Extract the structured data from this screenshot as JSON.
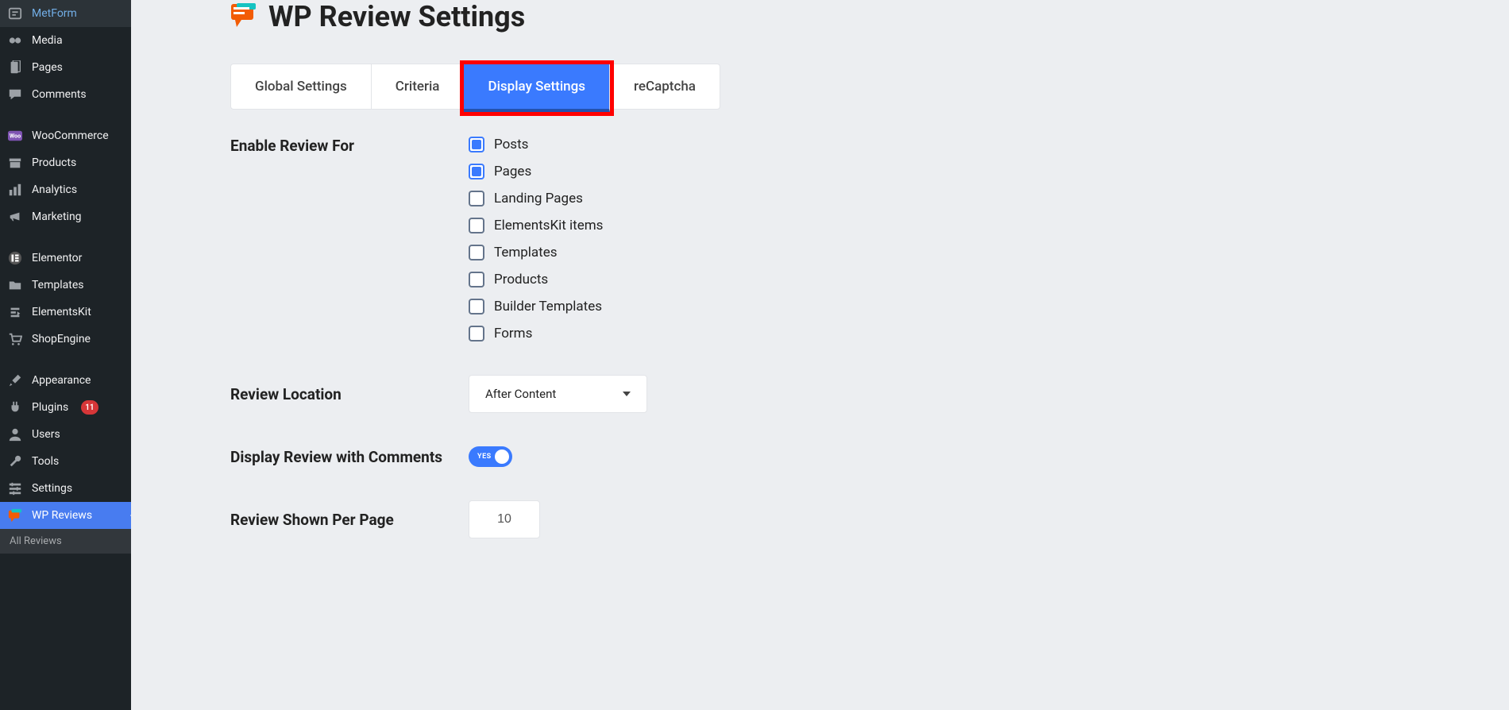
{
  "sidebar": {
    "items": [
      {
        "icon": "form",
        "label": "MetForm"
      },
      {
        "icon": "media",
        "label": "Media"
      },
      {
        "icon": "page",
        "label": "Pages"
      },
      {
        "icon": "comment",
        "label": "Comments"
      },
      {
        "icon": "woo",
        "label": "WooCommerce"
      },
      {
        "icon": "archive",
        "label": "Products"
      },
      {
        "icon": "chart",
        "label": "Analytics"
      },
      {
        "icon": "megaphone",
        "label": "Marketing"
      },
      {
        "icon": "elementor",
        "label": "Elementor"
      },
      {
        "icon": "folder",
        "label": "Templates"
      },
      {
        "icon": "elementskit",
        "label": "ElementsKit"
      },
      {
        "icon": "cart",
        "label": "ShopEngine"
      },
      {
        "icon": "brush",
        "label": "Appearance"
      },
      {
        "icon": "plug",
        "label": "Plugins",
        "badge": "11"
      },
      {
        "icon": "user",
        "label": "Users"
      },
      {
        "icon": "wrench",
        "label": "Tools"
      },
      {
        "icon": "sliders",
        "label": "Settings"
      },
      {
        "icon": "wp-review",
        "label": "WP Reviews",
        "active": true
      }
    ],
    "sub": "All Reviews"
  },
  "page": {
    "title": "WP Review Settings"
  },
  "tabs": [
    {
      "label": "Global Settings"
    },
    {
      "label": "Criteria"
    },
    {
      "label": "Display Settings",
      "active": true,
      "highlighted": true
    },
    {
      "label": "reCaptcha"
    }
  ],
  "settings": {
    "enable_label": "Enable Review For",
    "checks": [
      {
        "label": "Posts",
        "checked": true
      },
      {
        "label": "Pages",
        "checked": true
      },
      {
        "label": "Landing Pages",
        "checked": false
      },
      {
        "label": "ElementsKit items",
        "checked": false
      },
      {
        "label": "Templates",
        "checked": false
      },
      {
        "label": "Products",
        "checked": false
      },
      {
        "label": "Builder Templates",
        "checked": false
      },
      {
        "label": "Forms",
        "checked": false
      }
    ],
    "location_label": "Review Location",
    "location_value": "After Content",
    "display_with_comments_label": "Display Review with Comments",
    "toggle_text": "YES",
    "per_page_label": "Review Shown Per Page",
    "per_page_value": "10"
  }
}
